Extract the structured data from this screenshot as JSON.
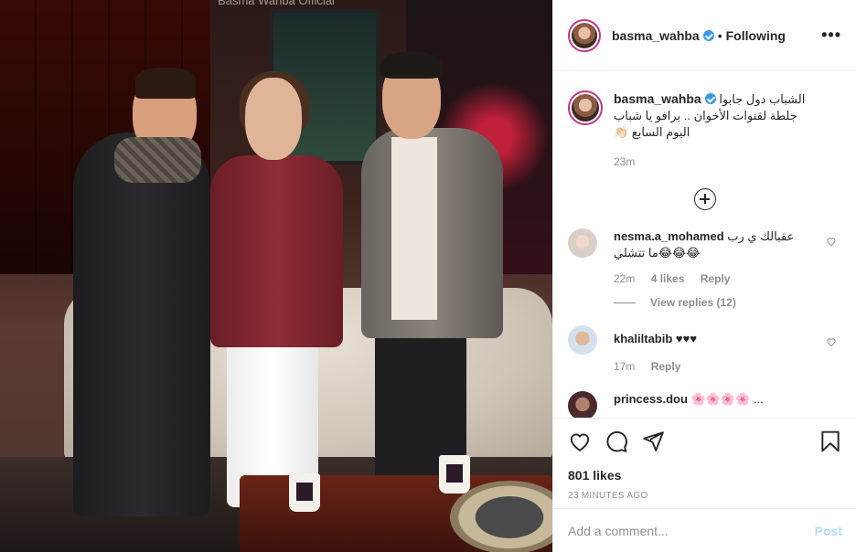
{
  "photo": {
    "overlay_title": "Basma Wahba Official"
  },
  "header": {
    "username": "basma_wahba",
    "dot": "•",
    "follow_status": "Following",
    "more": "•••"
  },
  "caption": {
    "username": "basma_wahba",
    "text_line1": "الشباب دول جابوا",
    "text_line2": "جلطة لقنوات الأخوان .. برافو يا شباب",
    "text_line3": "اليوم السابع 👏🏻",
    "time": "23m"
  },
  "comments": [
    {
      "username": "nesma.a_mohamed",
      "text": "عقبالك ي رب",
      "text2": "ما تتشلي😂😂😂",
      "time": "22m",
      "likes": "4 likes",
      "reply": "Reply",
      "view_replies": "View replies (12)"
    },
    {
      "username": "khaliltabib",
      "text": "♥♥♥",
      "time": "17m",
      "reply": "Reply"
    },
    {
      "username": "princess.dou",
      "text": "🌸🌸🌸🌸 ..."
    }
  ],
  "actions": {
    "likes": "801 likes",
    "time_ago": "23 MINUTES AGO"
  },
  "add_comment": {
    "placeholder": "Add a comment...",
    "post": "Post"
  },
  "colors": {
    "verified": "#3897f0",
    "post_disabled": "#b2dffc",
    "story_ring": "#c13584"
  }
}
